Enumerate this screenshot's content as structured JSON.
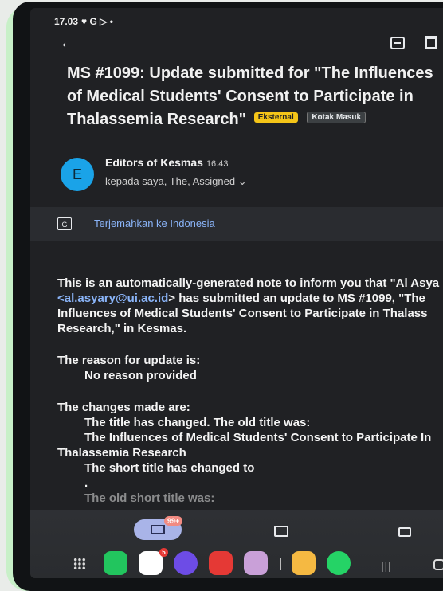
{
  "status_bar": {
    "time": "17.03",
    "indicators": "♥ G ▷ •"
  },
  "email": {
    "subject": "MS #1099: Update submitted for \"The Influences of Medical Students' Consent to Participate in Thalassemia Research\"",
    "labels": {
      "external": "Eksternal",
      "inbox": "Kotak Masuk"
    },
    "sender": {
      "initial": "E",
      "name": "Editors of Kesmas",
      "time": "16.43",
      "recipients": "kepada saya, The, Assigned ⌄"
    },
    "translate": {
      "icon": "translate-icon",
      "link": "Terjemahkan ke Indonesia"
    },
    "body": {
      "line1": "This is an automatically-generated note to inform you that \"Al Asya",
      "line2_link": "<al.asyary@ui.ac.id",
      "line2_rest": "> has submitted an update to MS #1099, \"The",
      "line3": "Influences of Medical Students' Consent to Participate in Thalass",
      "line4": "Research,\" in Kesmas.",
      "reason_heading": "The reason for update is:",
      "reason_value": "No reason provided",
      "changes_heading": "The changes made are:",
      "change1": "The title has changed. The old title was:",
      "old_title_1": "The Influences of Medical Students' Consent to Participate In",
      "old_title_2": "Thalassemia Research",
      "change2": "The short title has changed to",
      "dot": ".",
      "change3": "The old short title was:"
    }
  },
  "bottom_bar": {
    "mail_badge": "99+",
    "sms_badge": "5"
  },
  "colors": {
    "accent_link": "#8ab4f8",
    "external_chip": "#f5c518",
    "avatar": "#1aa3e8"
  }
}
